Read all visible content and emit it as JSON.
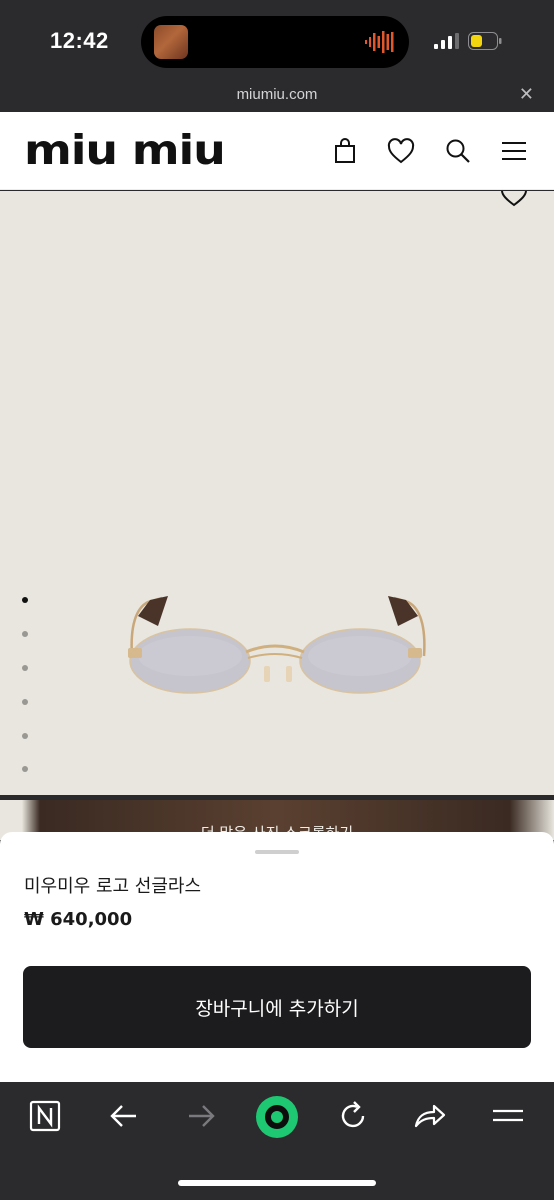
{
  "status_bar": {
    "time": "12:42",
    "icons": [
      "now-playing-thumbnail",
      "audio-waveform-icon",
      "signal-icon",
      "battery-icon"
    ],
    "battery_color": "#f2d50f",
    "wave_color": "#e2572b"
  },
  "browser": {
    "url": "miumiu.com",
    "close_symbol": "✕"
  },
  "header": {
    "logo": "miu miu",
    "icons": [
      "bag-icon",
      "heart-icon",
      "search-icon",
      "menu-icon"
    ]
  },
  "product": {
    "image_indicator": {
      "total": 6,
      "active_index": 0
    },
    "overlay_text": "더 많은 사진 스크롤하기",
    "name": "미우미우 로고 선글라스",
    "price": "₩ 640,000",
    "add_to_cart_label": "장바구니에 추가하기"
  },
  "toolbar": {
    "icons": [
      "notion-icon",
      "back-arrow-icon",
      "forward-arrow-icon",
      "home-circle-icon",
      "reload-icon",
      "share-icon",
      "menu-icon"
    ],
    "accent": "#1ec872"
  }
}
